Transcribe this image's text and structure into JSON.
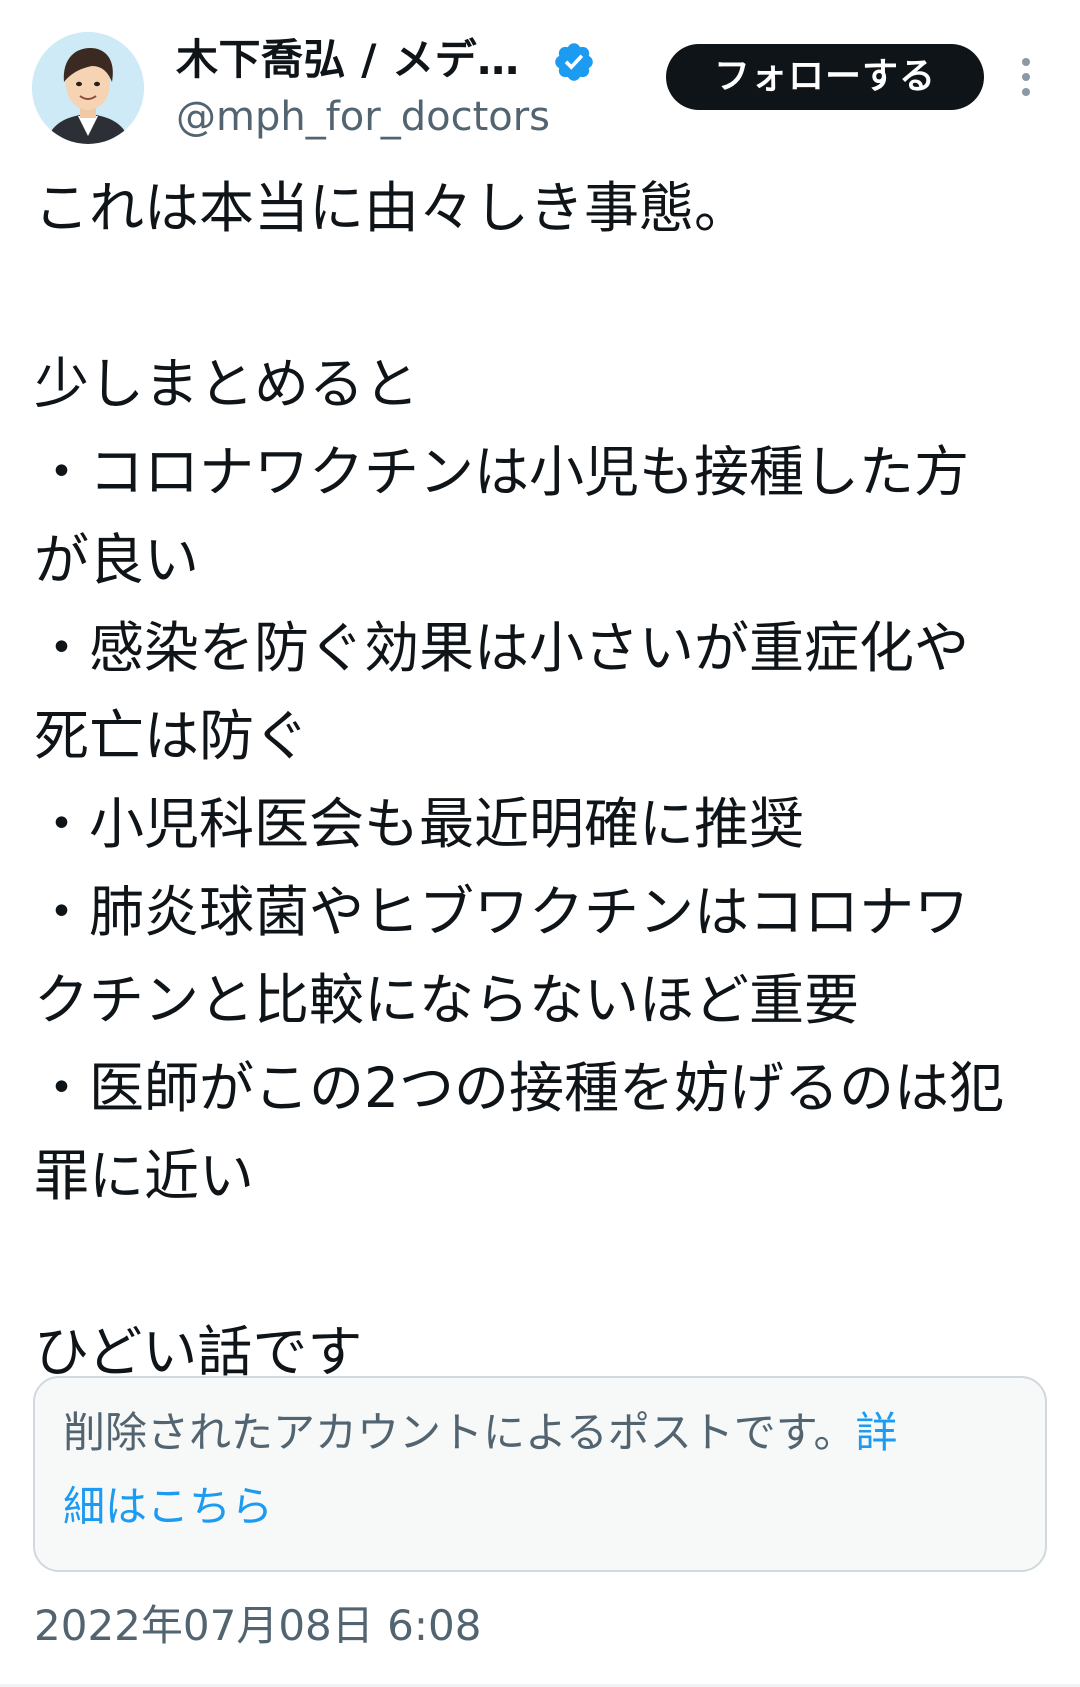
{
  "author": {
    "display_name": "木下喬弘 / メデ…",
    "handle": "@mph_for_doctors",
    "verified_icon": "verified-badge-icon",
    "avatar_icon": "avatar-illustration"
  },
  "follow_button": {
    "label": "フォローする"
  },
  "more_menu_icon": "more-vertical-icon",
  "post": {
    "lines": [
      "これは本当に由々しき事態。",
      "",
      "少しまとめると",
      "・コロナワクチンは小児も接種した方",
      "が良い",
      "・感染を防ぐ効果は小さいが重症化や",
      "死亡は防ぐ",
      "・小児科医会も最近明確に推奨",
      "・肺炎球菌やヒブワクチンはコロナワ",
      "クチンと比較にならないほど重要",
      "・医師がこの2つの接種を妨げるのは犯",
      "罪に近い",
      "",
      "ひどい話です"
    ]
  },
  "quoted_notice": {
    "text": "削除されたアカウントによるポストです。",
    "link_part1": "詳",
    "link_part2": "細はこちら"
  },
  "timestamp": "2022年07月08日 6:08",
  "colors": {
    "text": "#0f1419",
    "secondary": "#536471",
    "link": "#1d9bf0",
    "verified": "#1d9bf0",
    "button_bg": "#0f1419"
  }
}
